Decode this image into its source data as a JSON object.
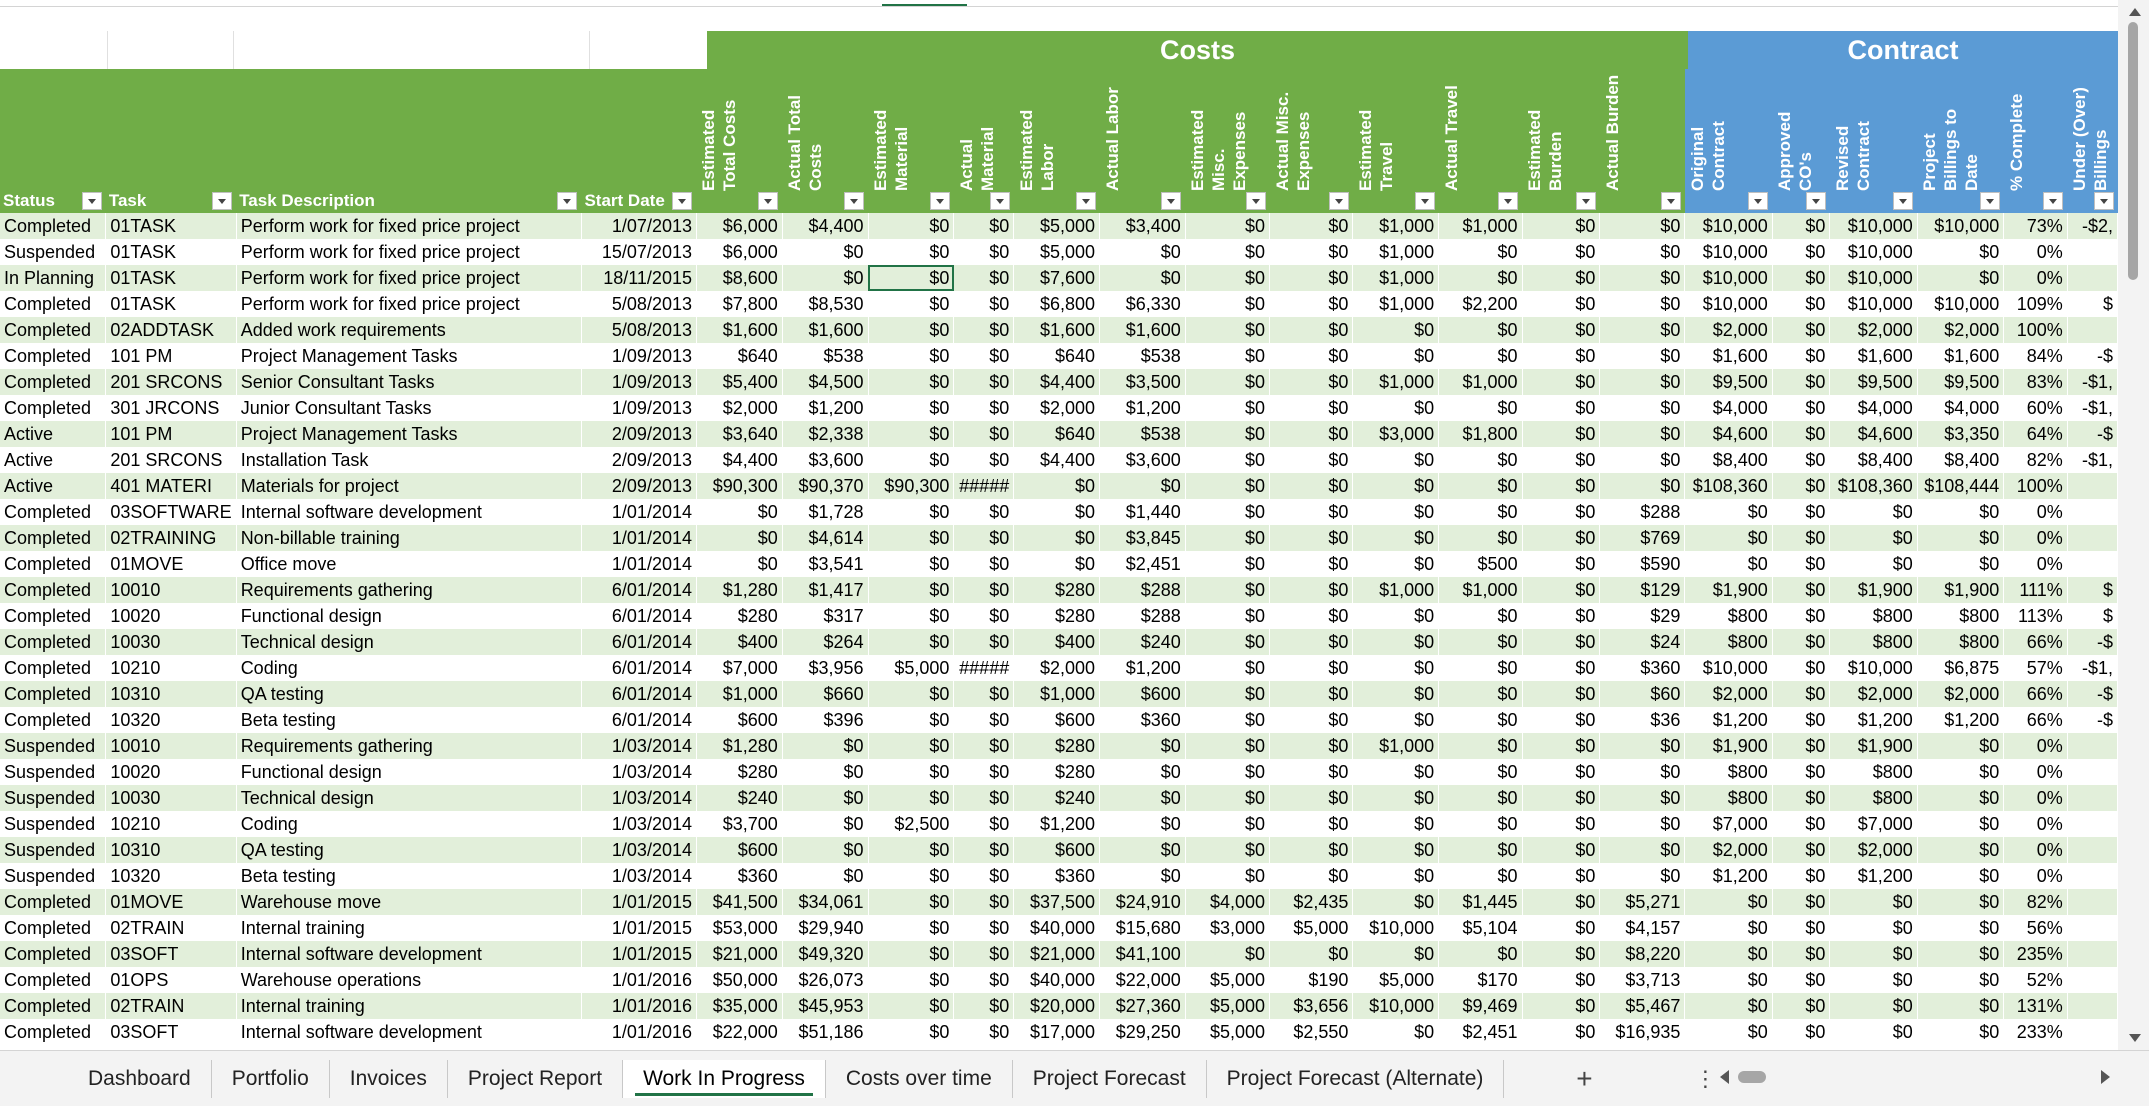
{
  "bands": {
    "costs": "Costs",
    "contract": "Contract"
  },
  "headers": [
    {
      "label": "Status",
      "color": "g",
      "rot": false
    },
    {
      "label": "Task",
      "color": "g",
      "rot": false
    },
    {
      "label": "Task Description",
      "color": "g",
      "rot": false
    },
    {
      "label": "Start Date",
      "color": "g",
      "rot": false
    },
    {
      "label": "Estimated Total Costs",
      "color": "g",
      "rot": true
    },
    {
      "label": "Actual Total Costs",
      "color": "g",
      "rot": true
    },
    {
      "label": "Estimated Material",
      "color": "g",
      "rot": true
    },
    {
      "label": "Actual Material",
      "color": "g",
      "rot": true
    },
    {
      "label": "Estimated Labor",
      "color": "g",
      "rot": true
    },
    {
      "label": "Actual Labor",
      "color": "g",
      "rot": true
    },
    {
      "label": "Estimated Misc. Expenses",
      "color": "g",
      "rot": true
    },
    {
      "label": "Actual Misc. Expenses",
      "color": "g",
      "rot": true
    },
    {
      "label": "Estimated Travel",
      "color": "g",
      "rot": true
    },
    {
      "label": "Actual Travel",
      "color": "g",
      "rot": true
    },
    {
      "label": "Estimated Burden",
      "color": "g",
      "rot": true
    },
    {
      "label": "Actual Burden",
      "color": "g",
      "rot": true
    },
    {
      "label": "Original Contract",
      "color": "b",
      "rot": true
    },
    {
      "label": "Approved CO's",
      "color": "b",
      "rot": true
    },
    {
      "label": "Revised Contract",
      "color": "b",
      "rot": true
    },
    {
      "label": "Project Billings to Date",
      "color": "b",
      "rot": true
    },
    {
      "label": "% Complete",
      "color": "b",
      "rot": true
    },
    {
      "label": "Under (Over) Billings",
      "color": "b",
      "rot": true
    }
  ],
  "rows": [
    [
      "Completed",
      "01TASK",
      "Perform work for fixed price project",
      "1/07/2013",
      "$6,000",
      "$4,400",
      "$0",
      "$0",
      "$5,000",
      "$3,400",
      "$0",
      "$0",
      "$1,000",
      "$1,000",
      "$0",
      "$0",
      "$10,000",
      "$0",
      "$10,000",
      "$10,000",
      "73%",
      "-$2,"
    ],
    [
      "Suspended",
      "01TASK",
      "Perform work for fixed price project",
      "15/07/2013",
      "$6,000",
      "$0",
      "$0",
      "$0",
      "$5,000",
      "$0",
      "$0",
      "$0",
      "$1,000",
      "$0",
      "$0",
      "$0",
      "$10,000",
      "$0",
      "$10,000",
      "$0",
      "0%",
      ""
    ],
    [
      "In Planning",
      "01TASK",
      "Perform work for fixed price project",
      "18/11/2015",
      "$8,600",
      "$0",
      "$0",
      "$0",
      "$7,600",
      "$0",
      "$0",
      "$0",
      "$1,000",
      "$0",
      "$0",
      "$0",
      "$10,000",
      "$0",
      "$10,000",
      "$0",
      "0%",
      ""
    ],
    [
      "Completed",
      "01TASK",
      "Perform work for fixed price project",
      "5/08/2013",
      "$7,800",
      "$8,530",
      "$0",
      "$0",
      "$6,800",
      "$6,330",
      "$0",
      "$0",
      "$1,000",
      "$2,200",
      "$0",
      "$0",
      "$10,000",
      "$0",
      "$10,000",
      "$10,000",
      "109%",
      "$"
    ],
    [
      "Completed",
      "02ADDTASK",
      "Added work requirements",
      "5/08/2013",
      "$1,600",
      "$1,600",
      "$0",
      "$0",
      "$1,600",
      "$1,600",
      "$0",
      "$0",
      "$0",
      "$0",
      "$0",
      "$0",
      "$2,000",
      "$0",
      "$2,000",
      "$2,000",
      "100%",
      ""
    ],
    [
      "Completed",
      "101 PM",
      "Project Management Tasks",
      "1/09/2013",
      "$640",
      "$538",
      "$0",
      "$0",
      "$640",
      "$538",
      "$0",
      "$0",
      "$0",
      "$0",
      "$0",
      "$0",
      "$1,600",
      "$0",
      "$1,600",
      "$1,600",
      "84%",
      "-$"
    ],
    [
      "Completed",
      "201 SRCONS",
      "Senior Consultant Tasks",
      "1/09/2013",
      "$5,400",
      "$4,500",
      "$0",
      "$0",
      "$4,400",
      "$3,500",
      "$0",
      "$0",
      "$1,000",
      "$1,000",
      "$0",
      "$0",
      "$9,500",
      "$0",
      "$9,500",
      "$9,500",
      "83%",
      "-$1,"
    ],
    [
      "Completed",
      "301 JRCONS",
      "Junior Consultant Tasks",
      "1/09/2013",
      "$2,000",
      "$1,200",
      "$0",
      "$0",
      "$2,000",
      "$1,200",
      "$0",
      "$0",
      "$0",
      "$0",
      "$0",
      "$0",
      "$4,000",
      "$0",
      "$4,000",
      "$4,000",
      "60%",
      "-$1,"
    ],
    [
      "Active",
      "101 PM",
      "Project Management Tasks",
      "2/09/2013",
      "$3,640",
      "$2,338",
      "$0",
      "$0",
      "$640",
      "$538",
      "$0",
      "$0",
      "$3,000",
      "$1,800",
      "$0",
      "$0",
      "$4,600",
      "$0",
      "$4,600",
      "$3,350",
      "64%",
      "-$"
    ],
    [
      "Active",
      "201 SRCONS",
      "Installation Task",
      "2/09/2013",
      "$4,400",
      "$3,600",
      "$0",
      "$0",
      "$4,400",
      "$3,600",
      "$0",
      "$0",
      "$0",
      "$0",
      "$0",
      "$0",
      "$8,400",
      "$0",
      "$8,400",
      "$8,400",
      "82%",
      "-$1,"
    ],
    [
      "Active",
      "401 MATERI",
      "Materials for project",
      "2/09/2013",
      "$90,300",
      "$90,370",
      "$90,300",
      "#####",
      "$0",
      "$0",
      "$0",
      "$0",
      "$0",
      "$0",
      "$0",
      "$0",
      "$108,360",
      "$0",
      "$108,360",
      "$108,444",
      "100%",
      ""
    ],
    [
      "Completed",
      "03SOFTWARE",
      "Internal software development",
      "1/01/2014",
      "$0",
      "$1,728",
      "$0",
      "$0",
      "$0",
      "$1,440",
      "$0",
      "$0",
      "$0",
      "$0",
      "$0",
      "$288",
      "$0",
      "$0",
      "$0",
      "$0",
      "0%",
      ""
    ],
    [
      "Completed",
      "02TRAINING",
      "Non-billable training",
      "1/01/2014",
      "$0",
      "$4,614",
      "$0",
      "$0",
      "$0",
      "$3,845",
      "$0",
      "$0",
      "$0",
      "$0",
      "$0",
      "$769",
      "$0",
      "$0",
      "$0",
      "$0",
      "0%",
      ""
    ],
    [
      "Completed",
      "01MOVE",
      "Office move",
      "1/01/2014",
      "$0",
      "$3,541",
      "$0",
      "$0",
      "$0",
      "$2,451",
      "$0",
      "$0",
      "$0",
      "$500",
      "$0",
      "$590",
      "$0",
      "$0",
      "$0",
      "$0",
      "0%",
      ""
    ],
    [
      "Completed",
      "10010",
      "Requirements gathering",
      "6/01/2014",
      "$1,280",
      "$1,417",
      "$0",
      "$0",
      "$280",
      "$288",
      "$0",
      "$0",
      "$1,000",
      "$1,000",
      "$0",
      "$129",
      "$1,900",
      "$0",
      "$1,900",
      "$1,900",
      "111%",
      "$"
    ],
    [
      "Completed",
      "10020",
      "Functional design",
      "6/01/2014",
      "$280",
      "$317",
      "$0",
      "$0",
      "$280",
      "$288",
      "$0",
      "$0",
      "$0",
      "$0",
      "$0",
      "$29",
      "$800",
      "$0",
      "$800",
      "$800",
      "113%",
      "$"
    ],
    [
      "Completed",
      "10030",
      "Technical design",
      "6/01/2014",
      "$400",
      "$264",
      "$0",
      "$0",
      "$400",
      "$240",
      "$0",
      "$0",
      "$0",
      "$0",
      "$0",
      "$24",
      "$800",
      "$0",
      "$800",
      "$800",
      "66%",
      "-$"
    ],
    [
      "Completed",
      "10210",
      "Coding",
      "6/01/2014",
      "$7,000",
      "$3,956",
      "$5,000",
      "#####",
      "$2,000",
      "$1,200",
      "$0",
      "$0",
      "$0",
      "$0",
      "$0",
      "$360",
      "$10,000",
      "$0",
      "$10,000",
      "$6,875",
      "57%",
      "-$1,"
    ],
    [
      "Completed",
      "10310",
      "QA testing",
      "6/01/2014",
      "$1,000",
      "$660",
      "$0",
      "$0",
      "$1,000",
      "$600",
      "$0",
      "$0",
      "$0",
      "$0",
      "$0",
      "$60",
      "$2,000",
      "$0",
      "$2,000",
      "$2,000",
      "66%",
      "-$"
    ],
    [
      "Completed",
      "10320",
      "Beta testing",
      "6/01/2014",
      "$600",
      "$396",
      "$0",
      "$0",
      "$600",
      "$360",
      "$0",
      "$0",
      "$0",
      "$0",
      "$0",
      "$36",
      "$1,200",
      "$0",
      "$1,200",
      "$1,200",
      "66%",
      "-$"
    ],
    [
      "Suspended",
      "10010",
      "Requirements gathering",
      "1/03/2014",
      "$1,280",
      "$0",
      "$0",
      "$0",
      "$280",
      "$0",
      "$0",
      "$0",
      "$1,000",
      "$0",
      "$0",
      "$0",
      "$1,900",
      "$0",
      "$1,900",
      "$0",
      "0%",
      ""
    ],
    [
      "Suspended",
      "10020",
      "Functional design",
      "1/03/2014",
      "$280",
      "$0",
      "$0",
      "$0",
      "$280",
      "$0",
      "$0",
      "$0",
      "$0",
      "$0",
      "$0",
      "$0",
      "$800",
      "$0",
      "$800",
      "$0",
      "0%",
      ""
    ],
    [
      "Suspended",
      "10030",
      "Technical design",
      "1/03/2014",
      "$240",
      "$0",
      "$0",
      "$0",
      "$240",
      "$0",
      "$0",
      "$0",
      "$0",
      "$0",
      "$0",
      "$0",
      "$800",
      "$0",
      "$800",
      "$0",
      "0%",
      ""
    ],
    [
      "Suspended",
      "10210",
      "Coding",
      "1/03/2014",
      "$3,700",
      "$0",
      "$2,500",
      "$0",
      "$1,200",
      "$0",
      "$0",
      "$0",
      "$0",
      "$0",
      "$0",
      "$0",
      "$7,000",
      "$0",
      "$7,000",
      "$0",
      "0%",
      ""
    ],
    [
      "Suspended",
      "10310",
      "QA testing",
      "1/03/2014",
      "$600",
      "$0",
      "$0",
      "$0",
      "$600",
      "$0",
      "$0",
      "$0",
      "$0",
      "$0",
      "$0",
      "$0",
      "$2,000",
      "$0",
      "$2,000",
      "$0",
      "0%",
      ""
    ],
    [
      "Suspended",
      "10320",
      "Beta testing",
      "1/03/2014",
      "$360",
      "$0",
      "$0",
      "$0",
      "$360",
      "$0",
      "$0",
      "$0",
      "$0",
      "$0",
      "$0",
      "$0",
      "$1,200",
      "$0",
      "$1,200",
      "$0",
      "0%",
      ""
    ],
    [
      "Completed",
      "01MOVE",
      "Warehouse move",
      "1/01/2015",
      "$41,500",
      "$34,061",
      "$0",
      "$0",
      "$37,500",
      "$24,910",
      "$4,000",
      "$2,435",
      "$0",
      "$1,445",
      "$0",
      "$5,271",
      "$0",
      "$0",
      "$0",
      "$0",
      "82%",
      ""
    ],
    [
      "Completed",
      "02TRAIN",
      "Internal training",
      "1/01/2015",
      "$53,000",
      "$29,940",
      "$0",
      "$0",
      "$40,000",
      "$15,680",
      "$3,000",
      "$5,000",
      "$10,000",
      "$5,104",
      "$0",
      "$4,157",
      "$0",
      "$0",
      "$0",
      "$0",
      "56%",
      ""
    ],
    [
      "Completed",
      "03SOFT",
      "Internal software development",
      "1/01/2015",
      "$21,000",
      "$49,320",
      "$0",
      "$0",
      "$21,000",
      "$41,100",
      "$0",
      "$0",
      "$0",
      "$0",
      "$0",
      "$8,220",
      "$0",
      "$0",
      "$0",
      "$0",
      "235%",
      ""
    ],
    [
      "Completed",
      "01OPS",
      "Warehouse operations",
      "1/01/2016",
      "$50,000",
      "$26,073",
      "$0",
      "$0",
      "$40,000",
      "$22,000",
      "$5,000",
      "$190",
      "$5,000",
      "$170",
      "$0",
      "$3,713",
      "$0",
      "$0",
      "$0",
      "$0",
      "52%",
      ""
    ],
    [
      "Completed",
      "02TRAIN",
      "Internal training",
      "1/01/2016",
      "$35,000",
      "$45,953",
      "$0",
      "$0",
      "$20,000",
      "$27,360",
      "$5,000",
      "$3,656",
      "$10,000",
      "$9,469",
      "$0",
      "$5,467",
      "$0",
      "$0",
      "$0",
      "$0",
      "131%",
      ""
    ],
    [
      "Completed",
      "03SOFT",
      "Internal software development",
      "1/01/2016",
      "$22,000",
      "$51,186",
      "$0",
      "$0",
      "$17,000",
      "$29,250",
      "$5,000",
      "$2,550",
      "$0",
      "$2,451",
      "$0",
      "$16,935",
      "$0",
      "$0",
      "$0",
      "$0",
      "233%",
      ""
    ]
  ],
  "tabs": [
    {
      "label": "Dashboard",
      "active": false
    },
    {
      "label": "Portfolio",
      "active": false
    },
    {
      "label": "Invoices",
      "active": false
    },
    {
      "label": "Project Report",
      "active": false
    },
    {
      "label": "Work In Progress",
      "active": true
    },
    {
      "label": "Costs over time",
      "active": false
    },
    {
      "label": "Project Forecast",
      "active": false
    },
    {
      "label": "Project Forecast (Alternate)",
      "active": false
    }
  ],
  "add_sheet_label": "+",
  "more_label": "⋮",
  "colors": {
    "green": "#70ad47",
    "blue": "#5b9bd5",
    "band_row": "#e2efda",
    "selection": "#217346"
  }
}
